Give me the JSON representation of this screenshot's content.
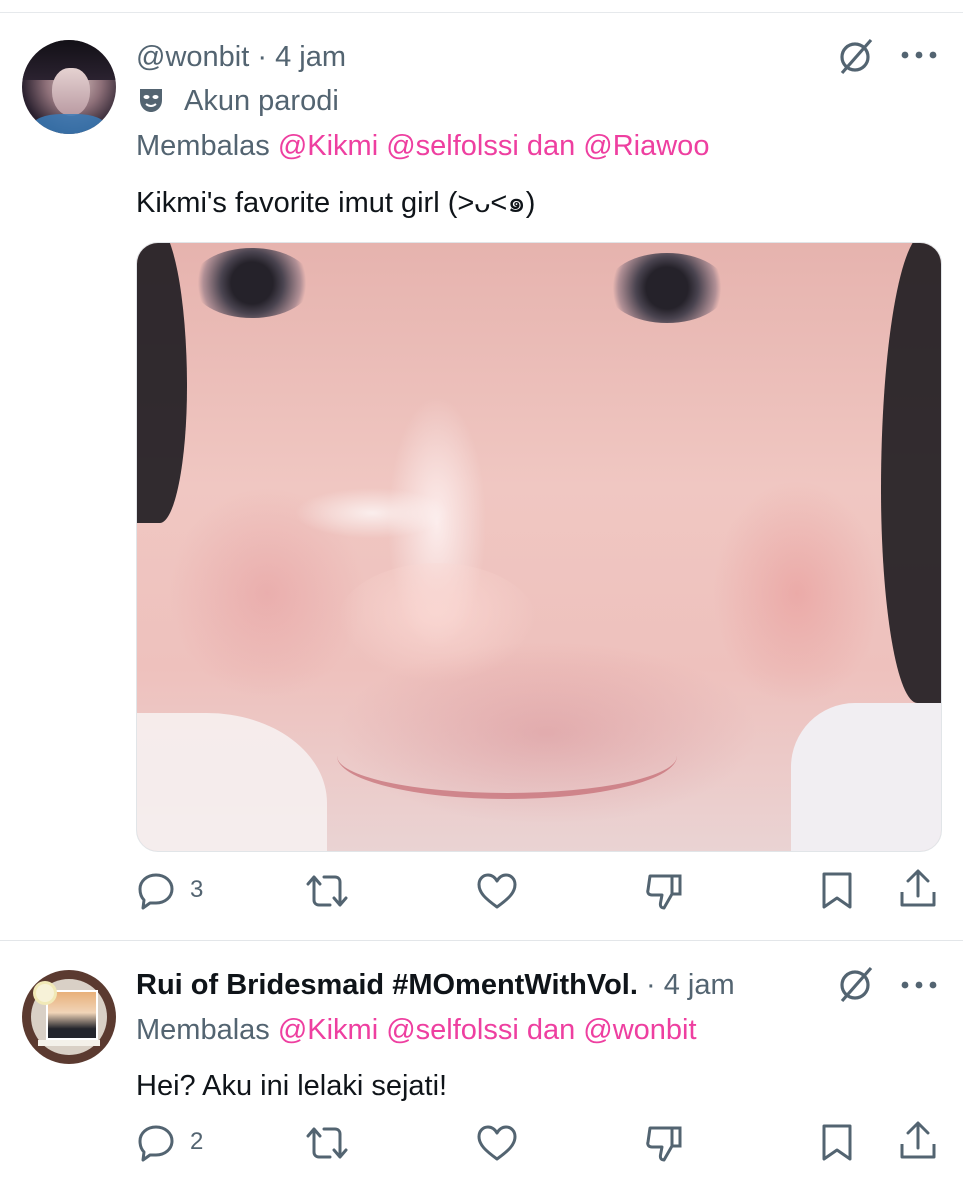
{
  "tweets": [
    {
      "author": "@wonbit",
      "dot": " · ",
      "time": "4 jam",
      "badge_label": "Akun parodi",
      "reply_prefix": "Membalas ",
      "reply_mentions": "@Kikmi @selfolssi dan @Riawoo",
      "text": "Kikmi's favorite imut girl (>ᴗ<๑)",
      "reply_count": "3",
      "icons": [
        "grok-icon",
        "more-icon",
        "reply-icon",
        "retweet-icon",
        "like-icon",
        "dislike-icon",
        "bookmark-icon",
        "share-icon"
      ]
    },
    {
      "author": "Rui of Bridesmaid #MOmentWithVol.",
      "dot": " · ",
      "time": "4 jam",
      "reply_prefix": "Membalas ",
      "reply_mentions": "@Kikmi @selfolssi dan @wonbit",
      "text": "Hei? Aku ini lelaki sejati!",
      "reply_count": "2"
    }
  ],
  "colors": {
    "mention": "#ee3fa0",
    "muted": "#536471",
    "text": "#0f1419"
  }
}
